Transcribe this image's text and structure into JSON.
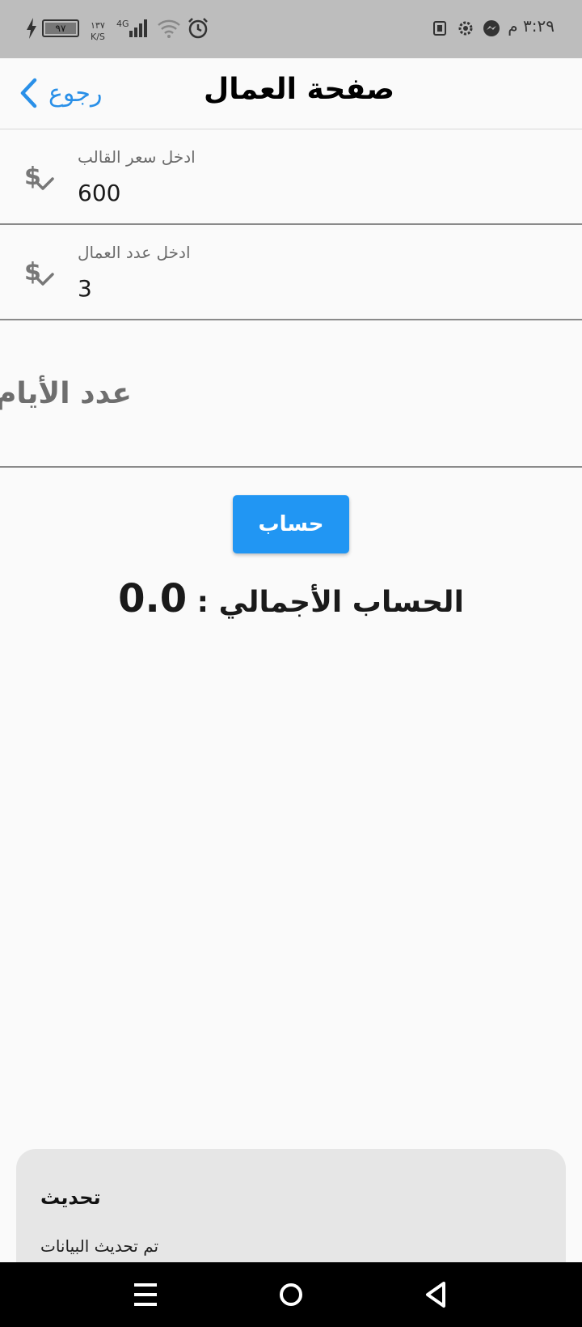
{
  "status_bar": {
    "time": "٣:٢٩ م",
    "battery_level": "٩٧",
    "network_speed": "١٣٧",
    "network_speed_unit": "K/S",
    "network_type": "4G"
  },
  "app_bar": {
    "back_label": "رجوع",
    "title": "صفحة العمال"
  },
  "form": {
    "mold_price": {
      "label": "ادخل سعر القالب",
      "value": "600"
    },
    "workers_count": {
      "label": "ادخل عدد العمال",
      "value": "3"
    },
    "days": {
      "placeholder": "عدد الأيام"
    }
  },
  "calculate_button_label": "حساب",
  "total": {
    "label": "الحساب الأجمالي :",
    "value": "0.0"
  },
  "snackbar": {
    "title": "تحديث",
    "message": "تم تحديث البيانات"
  },
  "colors": {
    "accent": "#2196f3",
    "back_link": "#2a90e8",
    "status_bar_bg": "#bdbdbd",
    "snackbar_bg": "#e6e6e6"
  }
}
